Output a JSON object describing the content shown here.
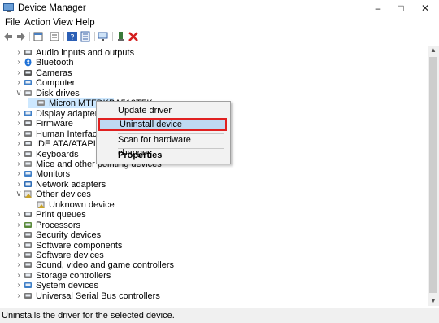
{
  "window": {
    "title": "Device Manager"
  },
  "menu": [
    "File",
    "Action",
    "View",
    "Help"
  ],
  "tree": [
    {
      "label": "Audio inputs and outputs",
      "icon": "speaker-icon",
      "expanded": false,
      "indent": 0
    },
    {
      "label": "Bluetooth",
      "icon": "bluetooth-icon",
      "expanded": false,
      "indent": 0
    },
    {
      "label": "Cameras",
      "icon": "camera-icon",
      "expanded": false,
      "indent": 0
    },
    {
      "label": "Computer",
      "icon": "computer-icon",
      "expanded": false,
      "indent": 0
    },
    {
      "label": "Disk drives",
      "icon": "disk-icon",
      "expanded": true,
      "indent": 0
    },
    {
      "label": "Micron MTFDKBA512TFK",
      "icon": "disk-icon",
      "expanded": null,
      "indent": 1,
      "selected": true
    },
    {
      "label": "Display adapters",
      "icon": "display-icon",
      "expanded": false,
      "indent": 0
    },
    {
      "label": "Firmware",
      "icon": "firmware-icon",
      "expanded": false,
      "indent": 0
    },
    {
      "label": "Human Interface Dev",
      "icon": "hid-icon",
      "expanded": false,
      "indent": 0
    },
    {
      "label": "IDE ATA/ATAPI contro",
      "icon": "ide-icon",
      "expanded": false,
      "indent": 0
    },
    {
      "label": "Keyboards",
      "icon": "keyboard-icon",
      "expanded": false,
      "indent": 0
    },
    {
      "label": "Mice and other pointing devices",
      "icon": "mouse-icon",
      "expanded": false,
      "indent": 0
    },
    {
      "label": "Monitors",
      "icon": "monitor-icon",
      "expanded": false,
      "indent": 0
    },
    {
      "label": "Network adapters",
      "icon": "network-icon",
      "expanded": false,
      "indent": 0
    },
    {
      "label": "Other devices",
      "icon": "other-devices-icon",
      "expanded": true,
      "indent": 0
    },
    {
      "label": "Unknown device",
      "icon": "unknown-device-icon",
      "expanded": null,
      "indent": 1
    },
    {
      "label": "Print queues",
      "icon": "printer-icon",
      "expanded": false,
      "indent": 0
    },
    {
      "label": "Processors",
      "icon": "processor-icon",
      "expanded": false,
      "indent": 0
    },
    {
      "label": "Security devices",
      "icon": "security-icon",
      "expanded": false,
      "indent": 0
    },
    {
      "label": "Software components",
      "icon": "software-component-icon",
      "expanded": false,
      "indent": 0
    },
    {
      "label": "Software devices",
      "icon": "software-device-icon",
      "expanded": false,
      "indent": 0
    },
    {
      "label": "Sound, video and game controllers",
      "icon": "sound-icon",
      "expanded": false,
      "indent": 0
    },
    {
      "label": "Storage controllers",
      "icon": "storage-icon",
      "expanded": false,
      "indent": 0
    },
    {
      "label": "System devices",
      "icon": "system-icon",
      "expanded": false,
      "indent": 0
    },
    {
      "label": "Universal Serial Bus controllers",
      "icon": "usb-icon",
      "expanded": false,
      "indent": 0
    }
  ],
  "context_menu": {
    "items": [
      "Update driver",
      "Uninstall device",
      "Scan for hardware changes",
      "Properties"
    ],
    "highlighted": "Uninstall device",
    "highlight_border_color": "#e02020"
  },
  "status": {
    "text": "Uninstalls the driver for the selected device."
  },
  "colors": {
    "selection": "#cde8ff",
    "menu_highlight": "#bfd9f2"
  }
}
